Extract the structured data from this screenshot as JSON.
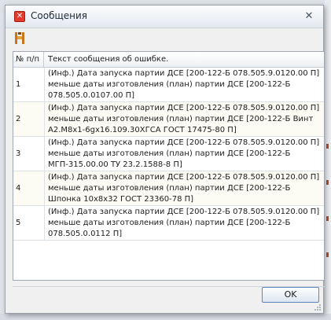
{
  "window": {
    "title": "Сообщения",
    "app_icon": "error-x-icon",
    "close_icon": "close-icon"
  },
  "toolbar": {
    "tool_icon": "export-icon"
  },
  "grid": {
    "columns": [
      "№ п/п",
      "Текст сообщения об ошибке."
    ],
    "rows": [
      {
        "num": "1",
        "message": "(Инф.) Дата запуска партии ДСЕ [200-122-Б 078.505.9.0120.00 П] меньше даты изготовления (план) партии ДСЕ [200-122-Б 078.505.0.0107.00 П]"
      },
      {
        "num": "2",
        "message": "(Инф.) Дата запуска партии ДСЕ [200-122-Б 078.505.9.0120.00 П] меньше даты изготовления (план) партии ДСЕ [200-122-Б Винт А2.М8х1-6gх16.109.30ХГСА ГОСТ 17475-80 П]"
      },
      {
        "num": "3",
        "message": "(Инф.) Дата запуска партии ДСЕ [200-122-Б 078.505.9.0120.00 П] меньше даты изготовления (план) партии ДСЕ [200-122-Б МГП-315.00.00 ТУ 23.2.1588-8 П]"
      },
      {
        "num": "4",
        "message": "(Инф.) Дата запуска партии ДСЕ [200-122-Б 078.505.9.0120.00 П] меньше даты изготовления (план) партии ДСЕ [200-122-Б Шпонка 10х8х32 ГОСТ 23360-78 П]"
      },
      {
        "num": "5",
        "message": "(Инф.) Дата запуска партии ДСЕ [200-122-Б 078.505.9.0120.00 П] меньше даты изготовления (план) партии ДСЕ [200-122-Б 078.505.0.0112 П]"
      }
    ]
  },
  "buttons": {
    "ok": "OK"
  }
}
